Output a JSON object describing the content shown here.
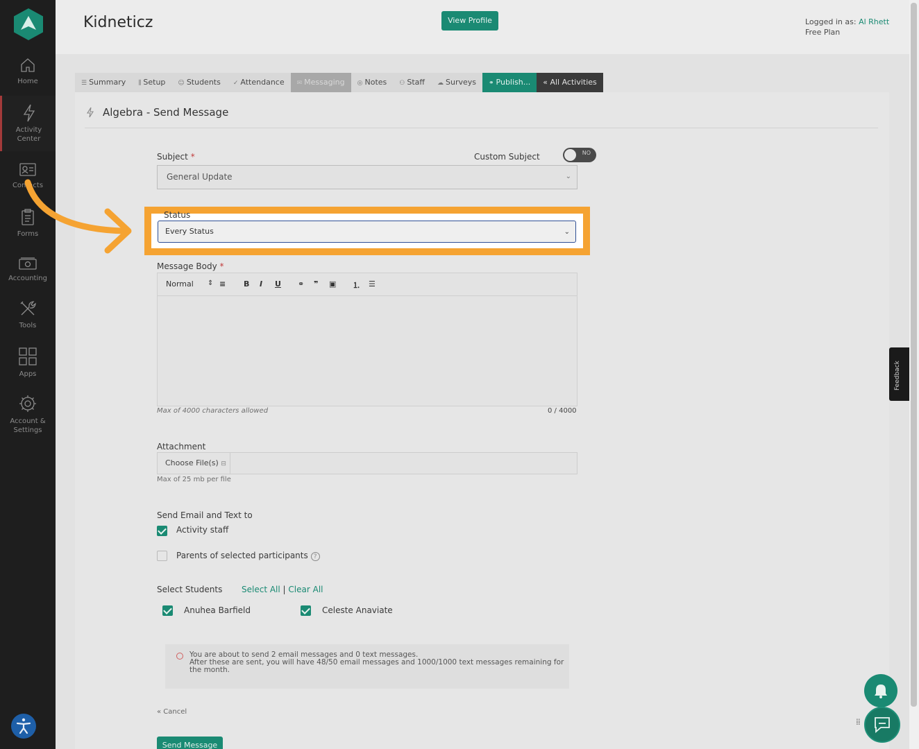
{
  "brand": "Kidneticz",
  "header": {
    "view_profile": "View Profile",
    "logged_in_prefix": "Logged in as: ",
    "user": "Al Rhett",
    "plan": "Free Plan"
  },
  "sidebar": {
    "items": [
      {
        "label1": "Home",
        "label2": ""
      },
      {
        "label1": "Activity",
        "label2": "Center"
      },
      {
        "label1": "Contacts",
        "label2": ""
      },
      {
        "label1": "Forms",
        "label2": ""
      },
      {
        "label1": "Accounting",
        "label2": ""
      },
      {
        "label1": "Tools",
        "label2": ""
      },
      {
        "label1": "Apps",
        "label2": ""
      },
      {
        "label1": "Account &",
        "label2": "Settings"
      }
    ]
  },
  "tabs": [
    "Summary",
    "Setup",
    "Students",
    "Attendance",
    "Messaging",
    "Notes",
    "Staff",
    "Surveys",
    "Publish...",
    "« All Activities"
  ],
  "page": {
    "title": "Algebra - Send Message"
  },
  "form": {
    "subject_label": "Subject",
    "required_mark": "*",
    "custom_subject_label": "Custom Subject",
    "toggle_text": "NO",
    "subject_value": "General Update",
    "status_label": "Status",
    "status_value": "Every Status",
    "body_label": "Message Body",
    "format_value": "Normal",
    "body_hint": "Max of 4000 characters allowed",
    "char_count": "0 / 4000",
    "attachment_label": "Attachment",
    "choose_files": "Choose File(s)",
    "attachment_hint": "Max of 25 mb per file",
    "send_to_label": "Send Email and Text to",
    "opt_staff": "Activity staff",
    "opt_parents": "Parents of selected participants",
    "select_students_label": "Select Students",
    "select_all": "Select All",
    "separator": "|",
    "clear_all": "Clear All",
    "students": [
      "Anuhea Barfield",
      "Celeste Anaviate"
    ],
    "notice_line1": "You are about to send 2 email messages and 0 text messages.",
    "notice_line2": "After these are sent, you will have 48/50 email messages and 1000/1000 text messages remaining for the month.",
    "cancel": "« Cancel",
    "send": "Send Message"
  },
  "feedback": "Feedback",
  "colors": {
    "accent": "#1a8a73",
    "highlight": "#f5a332",
    "sidebar": "#1e1e1e"
  }
}
